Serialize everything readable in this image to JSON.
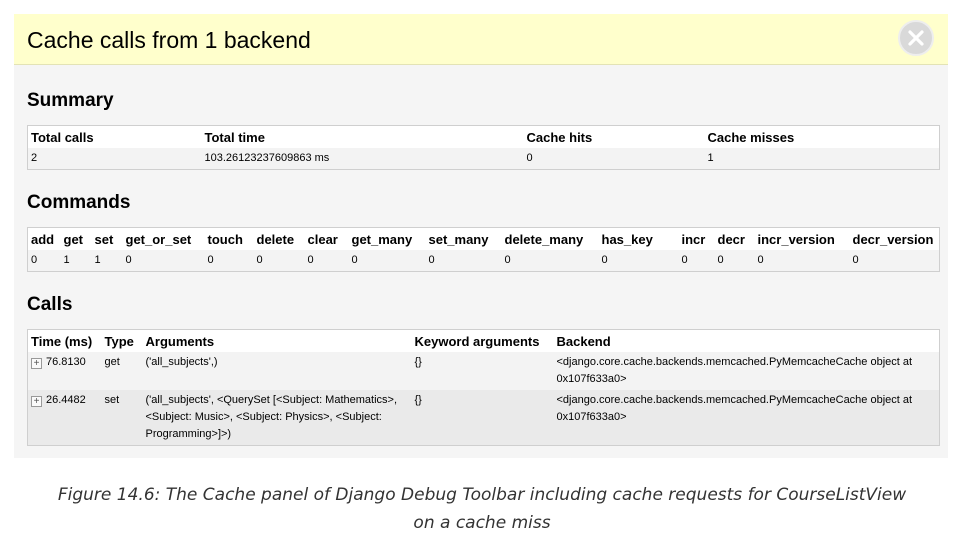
{
  "header": {
    "title": "Cache calls from 1 backend"
  },
  "summary": {
    "heading": "Summary",
    "columns": [
      "Total calls",
      "Total time",
      "Cache hits",
      "Cache misses"
    ],
    "values": [
      "2",
      "103.26123237609863 ms",
      "0",
      "1"
    ]
  },
  "commands": {
    "heading": "Commands",
    "columns": [
      "add",
      "get",
      "set",
      "get_or_set",
      "touch",
      "delete",
      "clear",
      "get_many",
      "set_many",
      "delete_many",
      "has_key",
      "incr",
      "decr",
      "incr_version",
      "decr_version"
    ],
    "values": [
      "0",
      "1",
      "1",
      "0",
      "0",
      "0",
      "0",
      "0",
      "0",
      "0",
      "0",
      "0",
      "0",
      "0",
      "0"
    ]
  },
  "calls": {
    "heading": "Calls",
    "columns": [
      "Time (ms)",
      "Type",
      "Arguments",
      "Keyword arguments",
      "Backend"
    ],
    "toggle_symbol": "+",
    "rows": [
      {
        "time": "76.8130",
        "type": "get",
        "arguments": "('all_subjects',)",
        "kwargs": "{}",
        "backend": "<django.core.cache.backends.memcached.PyMemcacheCache object at 0x107f633a0>"
      },
      {
        "time": "26.4482",
        "type": "set",
        "arguments": "('all_subjects', <QuerySet [<Subject: Mathematics>, <Subject: Music>, <Subject: Physics>, <Subject: Programming>]>)",
        "kwargs": "{}",
        "backend": "<django.core.cache.backends.memcached.PyMemcacheCache object at 0x107f633a0>"
      }
    ]
  },
  "caption": {
    "line1": "Figure 14.6: The Cache panel of Django Debug Toolbar including cache requests for CourseListView",
    "line2": "on a cache miss"
  }
}
